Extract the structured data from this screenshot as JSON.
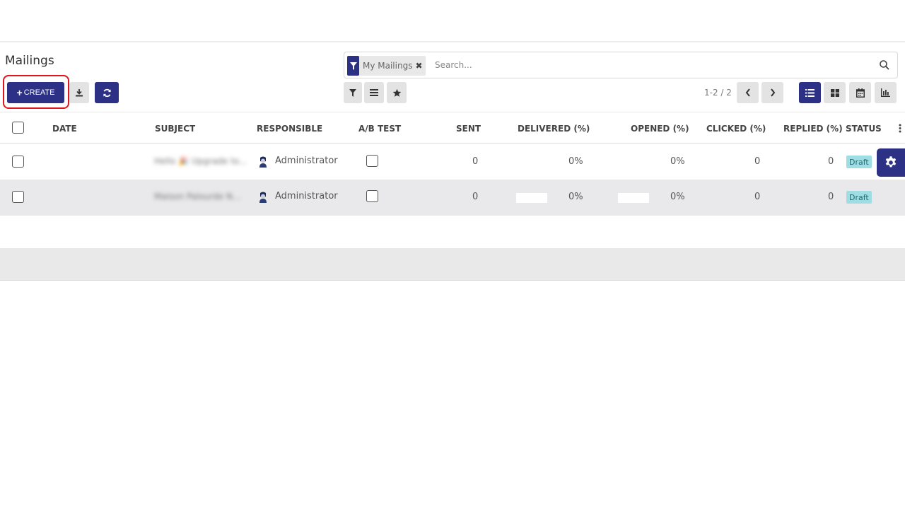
{
  "page": {
    "title": "Mailings"
  },
  "search": {
    "facet_label": "My Mailings",
    "facet_remove": "✖",
    "placeholder": "Search..."
  },
  "toolbar": {
    "create_plus": "+",
    "create_label": "CREATE",
    "download_icon": "download-icon",
    "refresh_icon": "refresh-icon"
  },
  "filters": {
    "icons": [
      "filter-icon",
      "groupby-icon",
      "favorite-icon"
    ]
  },
  "pager": {
    "text": "1-2 / 2"
  },
  "views": [
    "list-view",
    "kanban-view",
    "calendar-view",
    "graph-view"
  ],
  "table": {
    "columns": [
      "DATE",
      "SUBJECT",
      "RESPONSIBLE",
      "A/B TEST",
      "SENT",
      "DELIVERED (%)",
      "OPENED (%)",
      "CLICKED (%)",
      "REPLIED (%)",
      "STATUS"
    ],
    "rows": [
      {
        "date": "",
        "subject": "Hello 🎉 Upgrade to...",
        "responsible": "Administrator",
        "sent": "0",
        "delivered": "0%",
        "opened": "0%",
        "clicked": "0",
        "replied": "0",
        "status": "Draft"
      },
      {
        "date": "",
        "subject": "Maison Palourde N...",
        "responsible": "Administrator",
        "sent": "0",
        "delivered": "0%",
        "opened": "0%",
        "clicked": "0",
        "replied": "0",
        "status": "Draft"
      }
    ]
  },
  "colors": {
    "primary": "#2c3186",
    "highlight": "#e0151b",
    "badge": "#9fdde4"
  }
}
